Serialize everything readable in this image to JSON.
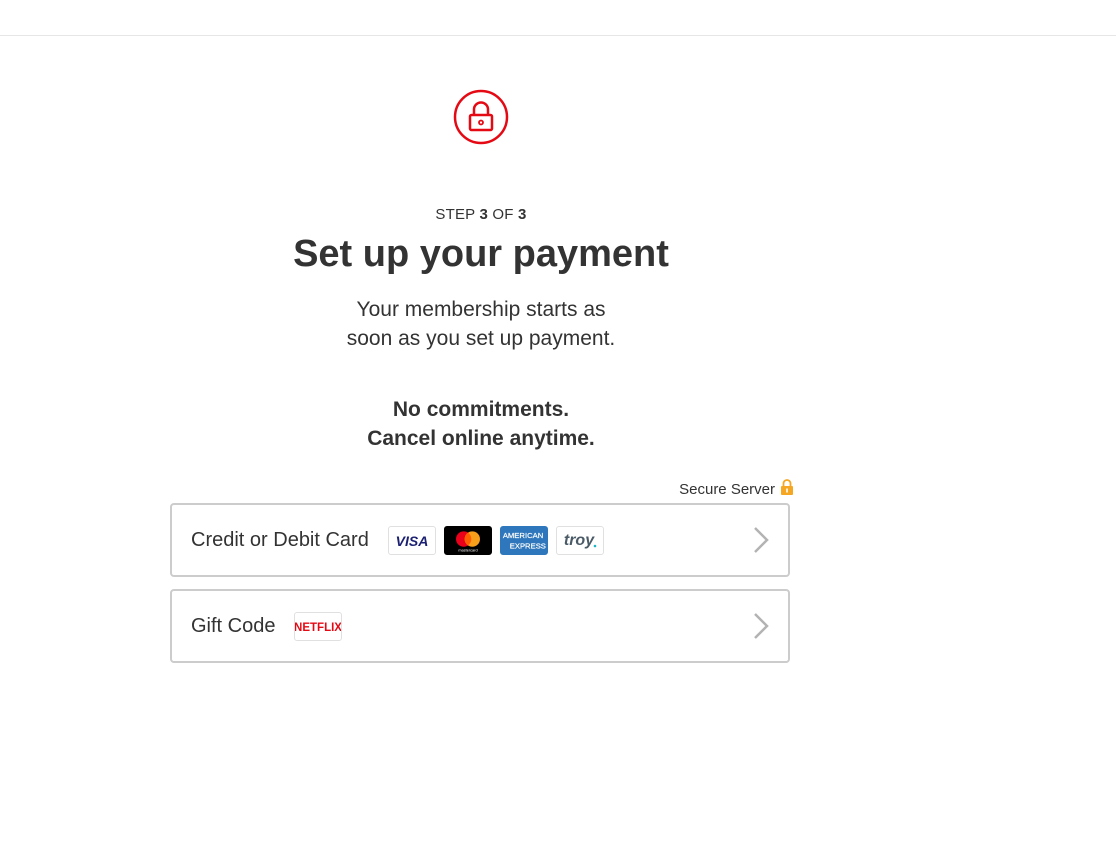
{
  "header": {},
  "page": {
    "step_prefix": "STEP",
    "step_current": "3",
    "step_of": "OF",
    "step_total": "3",
    "title": "Set up your payment",
    "subtitle": "Your membership starts as soon as you set up payment.",
    "emphasis_line1": "No commitments.",
    "emphasis_line2": "Cancel online anytime.",
    "secure_label": "Secure Server"
  },
  "options": [
    {
      "label": "Credit or Debit Card",
      "logos": [
        "visa-logo",
        "mastercard-logo",
        "american-express-logo",
        "troy-logo"
      ]
    },
    {
      "label": "Gift Code",
      "logos": [
        "netflix-logo"
      ]
    }
  ],
  "logo_text": {
    "visa": "VISA",
    "mastercard": "mastercard",
    "amex_line1": "AMERICAN",
    "amex_line2": "EXPRESS",
    "troy": "troy",
    "netflix": "NETFLIX"
  },
  "colors": {
    "accent_red": "#e50914",
    "lock_gold": "#f5a623",
    "border": "#cccccc",
    "text": "#333333"
  }
}
